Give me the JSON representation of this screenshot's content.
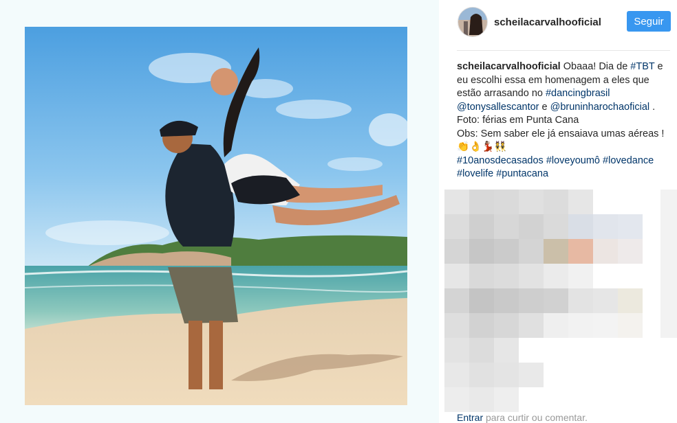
{
  "post": {
    "username": "scheilacarvalhooficial",
    "follow_label": "Seguir",
    "caption": {
      "username": "scheilacarvalhooficial",
      "segments": [
        {
          "text": " Obaaa! Dia de ",
          "type": "text"
        },
        {
          "text": "#TBT",
          "type": "link"
        },
        {
          "text": " e eu escolhi essa em homenagem a eles que estão arrasando no ",
          "type": "text"
        },
        {
          "text": "#dancingbrasil",
          "type": "link"
        },
        {
          "text": " ",
          "type": "text"
        },
        {
          "text": "@tonysallescantor",
          "type": "link"
        },
        {
          "text": " e ",
          "type": "text"
        },
        {
          "text": "@bruninharochaoficial",
          "type": "link"
        },
        {
          "text": " . Foto: férias em Punta Cana",
          "type": "text"
        },
        {
          "text": "Obs: Sem saber ele já ensaiava umas aéreas ! 👏👌💃🏽👯",
          "type": "text"
        },
        {
          "text": "#10anosdecasados",
          "type": "link"
        },
        {
          "text": " ",
          "type": "text"
        },
        {
          "text": "#loveyoumô",
          "type": "link"
        },
        {
          "text": " ",
          "type": "text"
        },
        {
          "text": "#lovedance",
          "type": "link"
        },
        {
          "text": " ",
          "type": "text"
        },
        {
          "text": "#lovelife",
          "type": "link"
        },
        {
          "text": " ",
          "type": "text"
        },
        {
          "text": "#puntacana",
          "type": "link"
        }
      ]
    },
    "login_prompt": {
      "link": "Entrar",
      "text": " para curtir ou comentar."
    }
  },
  "colors": {
    "follow_button": "#3897f0",
    "link": "#003569",
    "left_background": "#f3fbfc"
  }
}
